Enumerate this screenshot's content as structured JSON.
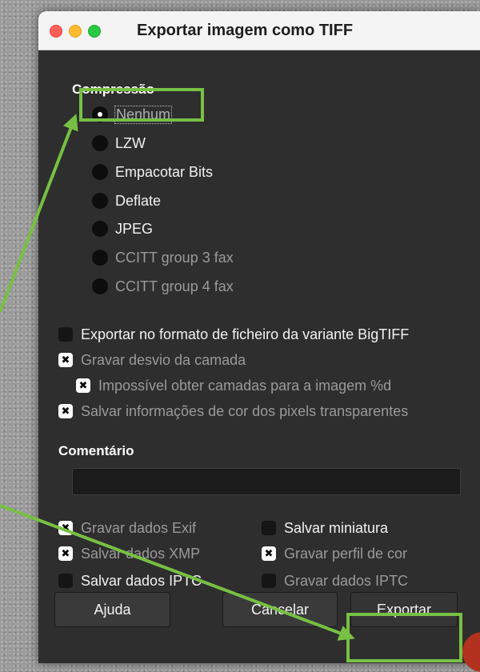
{
  "window": {
    "title": "Exportar imagem como TIFF"
  },
  "compression": {
    "label": "Compressão",
    "options": [
      {
        "label": "Nenhum",
        "selected": true
      },
      {
        "label": "LZW",
        "selected": false
      },
      {
        "label": "Empacotar Bits",
        "selected": false
      },
      {
        "label": "Deflate",
        "selected": false
      },
      {
        "label": "JPEG",
        "selected": false
      },
      {
        "label": "CCITT group 3 fax",
        "selected": false
      },
      {
        "label": "CCITT group 4 fax",
        "selected": false
      }
    ]
  },
  "options": {
    "bigtiff": {
      "label": "Exportar no formato de ficheiro da variante BigTIFF",
      "checked": false
    },
    "layer_offset": {
      "label": "Gravar desvio da camada",
      "checked": true
    },
    "layers_warning": {
      "label": "Impossível obter camadas para a imagem %d",
      "checked": true
    },
    "transparent_color": {
      "label": "Salvar informações de cor dos pixels transparentes",
      "checked": true
    }
  },
  "comment": {
    "label": "Comentário",
    "value": ""
  },
  "metadata": {
    "exif": {
      "label": "Gravar dados Exif",
      "checked": true
    },
    "xmp": {
      "label": "Salvar dados XMP",
      "checked": true
    },
    "iptc_save": {
      "label": "Salvar dados IPTC",
      "checked": false
    },
    "thumbnail": {
      "label": "Salvar miniatura",
      "checked": false
    },
    "color_profile": {
      "label": "Gravar perfil de cor",
      "checked": true
    },
    "iptc_write": {
      "label": "Gravar dados IPTC",
      "checked": false
    }
  },
  "buttons": {
    "help": "Ajuda",
    "cancel": "Cancelar",
    "export": "Exportar"
  },
  "colors": {
    "highlight": "#77c043"
  }
}
